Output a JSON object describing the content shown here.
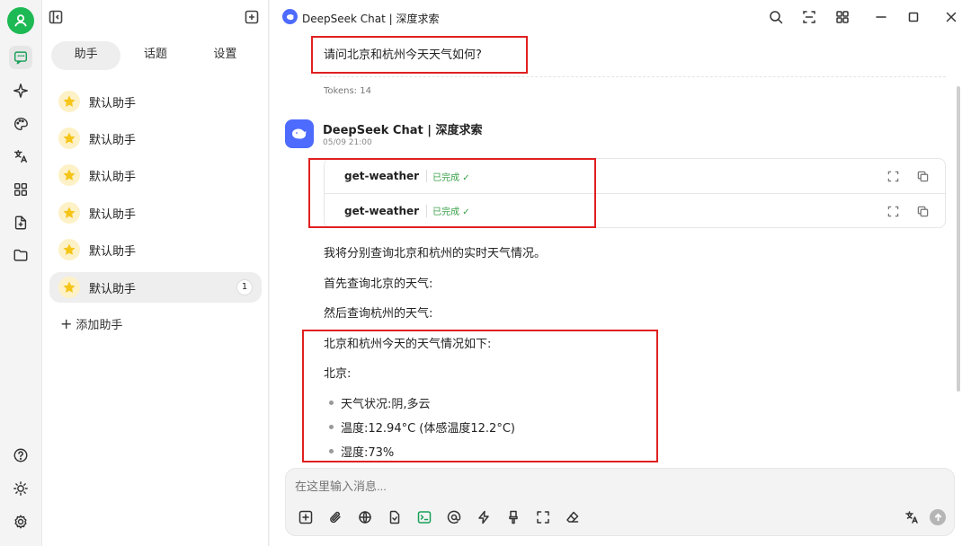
{
  "app": {
    "title": "DeepSeek Chat | 深度求索"
  },
  "sidebar_tabs": [
    "助手",
    "话题",
    "设置"
  ],
  "assistants": [
    {
      "name": "默认助手"
    },
    {
      "name": "默认助手"
    },
    {
      "name": "默认助手"
    },
    {
      "name": "默认助手"
    },
    {
      "name": "默认助手"
    },
    {
      "name": "默认助手",
      "count": "1"
    }
  ],
  "add_assistant_label": "添加助手",
  "chat": {
    "user_question": "请问北京和杭州今天天气如何?",
    "tokens": "Tokens: 14",
    "bot_name": "DeepSeek Chat | 深度求索",
    "bot_time": "05/09 21:00",
    "tool_calls": [
      {
        "name": "get-weather",
        "status": "已完成 ✓"
      },
      {
        "name": "get-weather",
        "status": "已完成 ✓"
      }
    ],
    "para1": "我将分别查询北京和杭州的实时天气情况。",
    "para2": "首先查询北京的天气:",
    "para3": "然后查询杭州的天气:",
    "para4": "北京和杭州今天的天气情况如下:",
    "para5": "北京:",
    "bullets": [
      "天气状况:阴,多云",
      "温度:12.94°C (体感温度12.2°C)",
      "湿度:73%"
    ]
  },
  "composer": {
    "placeholder": "在这里输入消息..."
  },
  "colors": {
    "accent_green": "#18a058",
    "deepseek_blue": "#4d6bfe",
    "highlight_red": "#e02020",
    "status_green": "#3aa14a"
  },
  "icons": {
    "rail": [
      "chat-icon",
      "sparkle-icon",
      "palette-icon",
      "translate-icon",
      "apps-icon",
      "file-import-icon",
      "folder-icon",
      "help-icon",
      "theme-sun-icon",
      "settings-gear-icon"
    ],
    "composer": [
      "new-topic-icon",
      "attachment-icon",
      "web-search-icon",
      "knowledge-icon",
      "mcp-terminal-icon",
      "mention-icon",
      "quick-phrase-icon",
      "clear-brush-icon",
      "expand-icon",
      "eraser-icon",
      "translate-icon",
      "send-icon"
    ]
  }
}
